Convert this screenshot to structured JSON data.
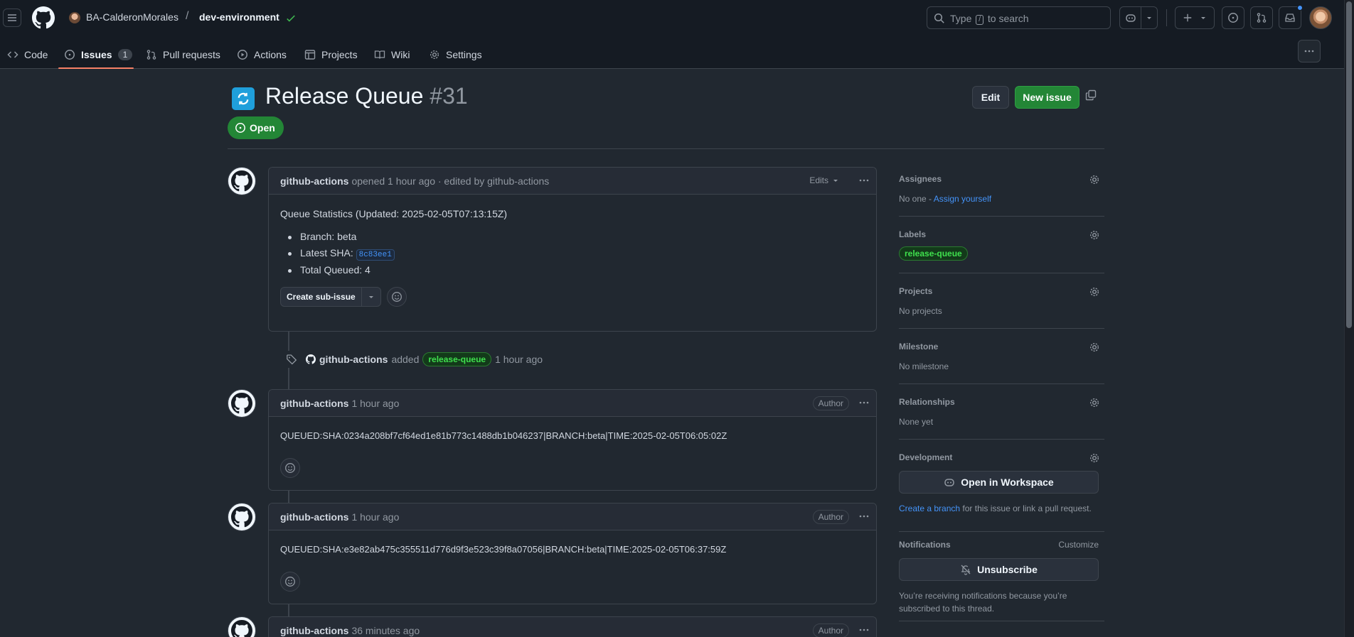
{
  "header": {
    "owner": "BA-CalderonMorales",
    "separator": "/",
    "repo": "dev-environment",
    "search_placeholder_pre": "Type",
    "search_key": "/",
    "search_placeholder_post": "to search"
  },
  "tabs": [
    {
      "label": "Code",
      "icon": "code-icon"
    },
    {
      "label": "Issues",
      "icon": "issue-opened-icon",
      "count": "1",
      "selected": true
    },
    {
      "label": "Pull requests",
      "icon": "git-pull-request-icon"
    },
    {
      "label": "Actions",
      "icon": "play-icon"
    },
    {
      "label": "Projects",
      "icon": "table-icon"
    },
    {
      "label": "Wiki",
      "icon": "book-icon"
    },
    {
      "label": "Settings",
      "icon": "gear-icon"
    }
  ],
  "issue": {
    "title": "Release Queue",
    "number": "#31",
    "state": "Open",
    "edit_label": "Edit",
    "new_issue_label": "New issue"
  },
  "opening_comment": {
    "author": "github-actions",
    "meta": "opened 1 hour ago · edited by github-actions",
    "edits_label": "Edits",
    "heading": "Queue Statistics (Updated: 2025-02-05T07:13:15Z)",
    "items": [
      {
        "label": "Branch: beta"
      },
      {
        "label": "Latest SHA:",
        "sha": "8c83ee1"
      },
      {
        "label": "Total Queued: 4"
      }
    ],
    "sub_issue_label": "Create sub-issue"
  },
  "label_event": {
    "actor": "github-actions",
    "action": "added",
    "label": "release-queue",
    "time": "1 hour ago"
  },
  "comments": [
    {
      "author": "github-actions",
      "time": "1 hour ago",
      "badge": "Author",
      "body": "QUEUED:SHA:0234a208bf7cf64ed1e81b773c1488db1b046237|BRANCH:beta|TIME:2025-02-05T06:05:02Z"
    },
    {
      "author": "github-actions",
      "time": "1 hour ago",
      "badge": "Author",
      "body": "QUEUED:SHA:e3e82ab475c355511d776d9f3e523c39f8a07056|BRANCH:beta|TIME:2025-02-05T06:37:59Z"
    },
    {
      "author": "github-actions",
      "time": "36 minutes ago",
      "badge": "Author"
    }
  ],
  "sidebar": {
    "assignees": {
      "heading": "Assignees",
      "none": "No one -",
      "assign_link": "Assign yourself"
    },
    "labels": {
      "heading": "Labels",
      "label": "release-queue"
    },
    "projects": {
      "heading": "Projects",
      "value": "No projects"
    },
    "milestone": {
      "heading": "Milestone",
      "value": "No milestone"
    },
    "relationships": {
      "heading": "Relationships",
      "value": "None yet"
    },
    "development": {
      "heading": "Development",
      "button": "Open in Workspace",
      "link": "Create a branch",
      "suffix": "for this issue or link a pull request."
    },
    "notifications": {
      "heading": "Notifications",
      "customize": "Customize",
      "button": "Unsubscribe",
      "reason": "You’re receiving notifications because you’re subscribed to this thread."
    }
  },
  "colors": {
    "accent": "#4493f8",
    "open_green": "#238636",
    "label_green": "#3fe04d",
    "tab_underline": "#f78166"
  }
}
